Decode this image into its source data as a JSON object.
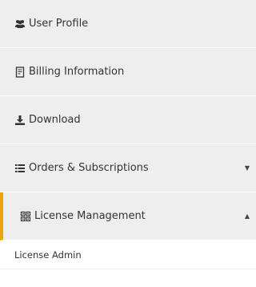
{
  "menu": {
    "items": [
      {
        "label": "User Profile",
        "icon": "users-icon"
      },
      {
        "label": "Billing Information",
        "icon": "receipt-icon"
      },
      {
        "label": "Download",
        "icon": "download-icon"
      },
      {
        "label": "Orders & Subscriptions",
        "icon": "list-icon",
        "caret": "▼"
      },
      {
        "label": "License Management",
        "icon": "grid-icon",
        "caret": "▲",
        "active": true
      }
    ],
    "submenu": [
      {
        "label": "License Admin"
      }
    ]
  },
  "colors": {
    "item_bg": "#eeeeee",
    "active_accent": "#f0a30a",
    "text": "#333333"
  }
}
